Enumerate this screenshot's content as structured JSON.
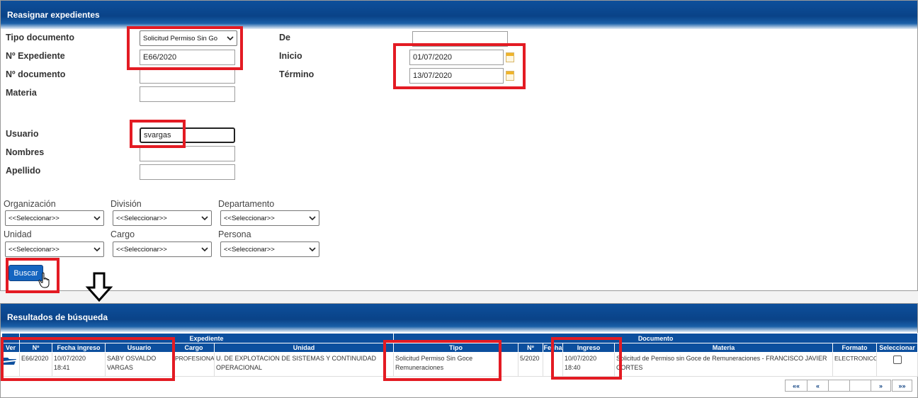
{
  "search_panel": {
    "title": "Reasignar expedientes",
    "labels": {
      "tipo_documento": "Tipo documento",
      "n_expediente": "Nº Expediente",
      "n_documento": "Nº documento",
      "materia": "Materia",
      "de": "De",
      "inicio": "Inicio",
      "termino": "Término",
      "usuario": "Usuario",
      "nombres": "Nombres",
      "apellido": "Apellido"
    },
    "tipo_documento_value": "Solicitud Permiso Sin Go",
    "n_expediente_value": "E66/2020",
    "inicio_value": "01/07/2020",
    "termino_value": "13/07/2020",
    "usuario_value": "svargas",
    "filters": [
      {
        "label": "Organización",
        "value": "<<Seleccionar>>"
      },
      {
        "label": "División",
        "value": "<<Seleccionar>>"
      },
      {
        "label": "Departamento",
        "value": "<<Seleccionar>>"
      },
      {
        "label": "Unidad",
        "value": "<<Seleccionar>>"
      },
      {
        "label": "Cargo",
        "value": "<<Seleccionar>>"
      },
      {
        "label": "Persona",
        "value": "<<Seleccionar>>"
      }
    ],
    "search_button": "Buscar"
  },
  "results_panel": {
    "title": "Resultados de búsqueda",
    "group_headers": {
      "expediente": "Expediente",
      "documento": "Documento"
    },
    "columns": [
      "Ver",
      "Nº",
      "Fecha ingreso",
      "Usuario",
      "Cargo",
      "Unidad",
      "Tipo",
      "Nº",
      "Fecha",
      "Ingreso",
      "Materia",
      "Formato",
      "Seleccionar"
    ],
    "rows": [
      {
        "numero": "E66/2020",
        "fecha_ingreso_1": "10/07/2020",
        "fecha_ingreso_2": "18:41",
        "usuario_1": "SABY OSVALDO",
        "usuario_2": "VARGAS",
        "cargo": "PROFESIONAL",
        "unidad_1": "U. DE EXPLOTACION DE SISTEMAS Y CONTINUIDAD",
        "unidad_2": "OPERACIONAL",
        "tipo_1": "Solicitud Permiso Sin Goce",
        "tipo_2": "Remuneraciones",
        "doc_numero": "5/2020",
        "ingreso_1": "10/07/2020",
        "ingreso_2": "18:40",
        "materia_1": "Solicitud de Permiso sin Goce de Remuneraciones - FRANCISCO JAVIER",
        "materia_2": "CORTES",
        "formato": "ELECTRONICO"
      }
    ],
    "pagination": [
      "««",
      "«",
      "",
      "",
      "»",
      "»»"
    ]
  },
  "colors": {
    "header_blue": "#0a4388",
    "highlight_red": "#e31b23",
    "button_blue": "#1565c0"
  }
}
